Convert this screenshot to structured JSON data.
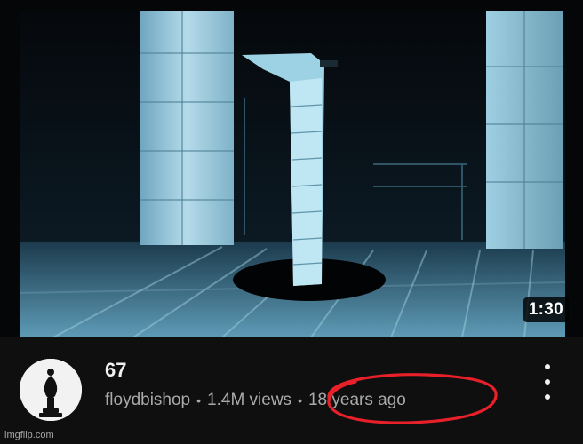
{
  "video": {
    "title": "67",
    "channel": "floydbishop",
    "views": "1.4M views",
    "separator": "•",
    "age": "18 years ago",
    "duration": "1:30"
  },
  "icons": {
    "menu": "more-vert-icon",
    "avatar": "chess-bishop-icon"
  },
  "annotation": {
    "color": "#e8202a"
  },
  "watermark": "imgflip.com"
}
